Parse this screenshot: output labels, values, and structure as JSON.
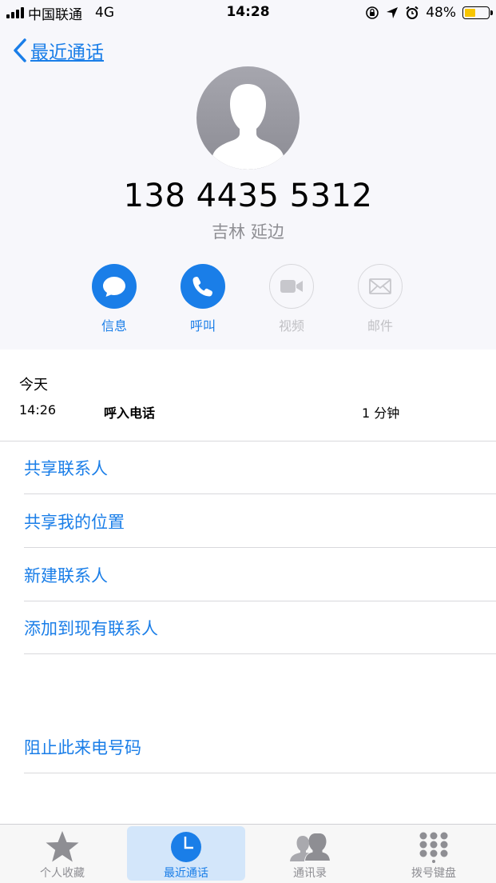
{
  "status_bar": {
    "carrier": "中国联通",
    "network": "4G",
    "time": "14:28",
    "battery": "48%",
    "battery_level": 0.48,
    "battery_color": "#f7c500"
  },
  "nav": {
    "back_label": "最近通话"
  },
  "contact": {
    "phone_number": "138 4435 5312",
    "location": "吉林 延边"
  },
  "actions": [
    {
      "label": "信息",
      "icon": "message-icon",
      "enabled": true
    },
    {
      "label": "呼叫",
      "icon": "phone-icon",
      "enabled": true
    },
    {
      "label": "视频",
      "icon": "video-icon",
      "enabled": false
    },
    {
      "label": "邮件",
      "icon": "mail-icon",
      "enabled": false
    }
  ],
  "call_history": {
    "title": "今天",
    "entries": [
      {
        "time": "14:26",
        "type": "呼入电话",
        "duration": "1 分钟"
      }
    ]
  },
  "options": [
    "共享联系人",
    "共享我的位置",
    "新建联系人",
    "添加到现有联系人"
  ],
  "block_option": "阻止此来电号码",
  "tabs": [
    {
      "label": "个人收藏",
      "icon": "star-icon",
      "selected": false
    },
    {
      "label": "最近通话",
      "icon": "clock-icon",
      "selected": true
    },
    {
      "label": "通讯录",
      "icon": "contacts-icon",
      "selected": false
    },
    {
      "label": "拨号键盘",
      "icon": "keypad-icon",
      "selected": false
    }
  ],
  "colors": {
    "accent": "#1a7ee8",
    "header_bg": "#f7f7fb",
    "secondary_text": "#8e8e93"
  }
}
